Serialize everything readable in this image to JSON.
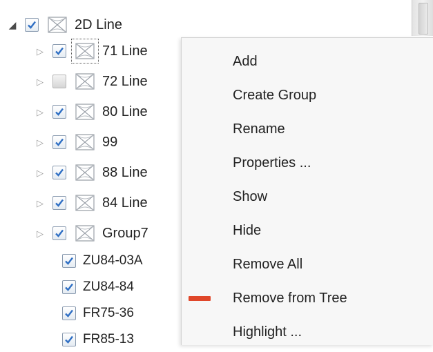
{
  "tree": {
    "root": {
      "label": "2D Line",
      "checked": true,
      "expanded": true
    },
    "layers": [
      {
        "label": "71 Line",
        "checked": true,
        "focused": true
      },
      {
        "label": "72 Line",
        "checked": false
      },
      {
        "label": "80 Line",
        "checked": true
      },
      {
        "label": "99",
        "checked": true
      },
      {
        "label": "88 Line",
        "checked": true
      },
      {
        "label": "84 Line",
        "checked": true
      },
      {
        "label": "Group7",
        "checked": true
      }
    ],
    "items": [
      {
        "label": "ZU84-03A",
        "checked": true
      },
      {
        "label": "ZU84-84",
        "checked": true
      },
      {
        "label": "FR75-36",
        "checked": true
      },
      {
        "label": "FR85-13",
        "checked": true
      }
    ],
    "icons": {
      "expanded": "triangle-down-icon",
      "collapsed": "triangle-right-icon",
      "layer": "line-layer-icon",
      "check": "checkmark-icon"
    }
  },
  "context_menu": {
    "items": [
      {
        "label": "Add",
        "icon": null
      },
      {
        "label": "Create Group",
        "icon": null
      },
      {
        "label": "Rename",
        "icon": null
      },
      {
        "label": "Properties ...",
        "icon": null
      },
      {
        "label": "Show",
        "icon": null
      },
      {
        "label": "Hide",
        "icon": null
      },
      {
        "label": "Remove All",
        "icon": null
      },
      {
        "label": "Remove from Tree",
        "icon": "remove-icon"
      },
      {
        "label": "Highlight ...",
        "icon": null
      }
    ],
    "remove_icon_color": "#e0472a"
  },
  "colors": {
    "check": "#2f6fc4",
    "menu_bg": "#f7f7f7"
  }
}
